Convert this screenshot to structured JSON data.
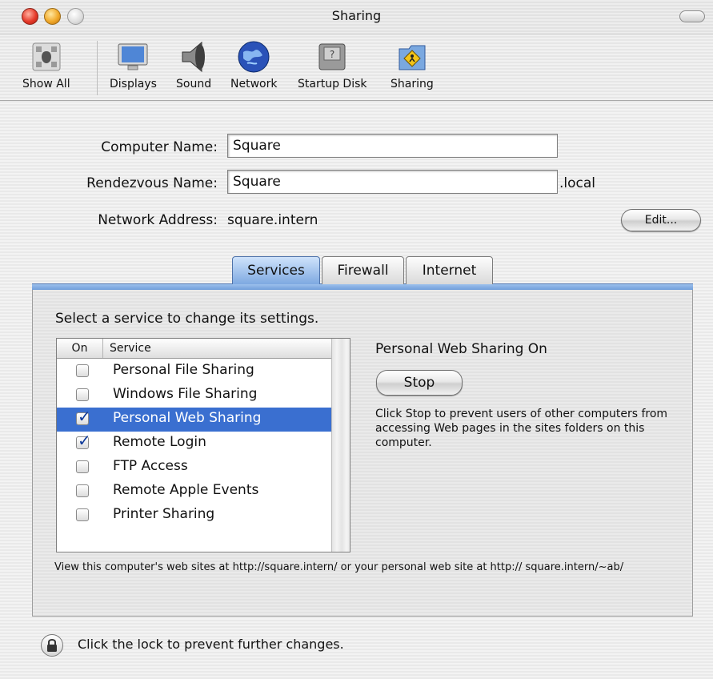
{
  "window": {
    "title": "Sharing"
  },
  "toolbar": {
    "items": [
      {
        "label": "Show All",
        "icon": "apple-grid-icon"
      },
      {
        "label": "Displays",
        "icon": "display-icon"
      },
      {
        "label": "Sound",
        "icon": "speaker-icon"
      },
      {
        "label": "Network",
        "icon": "globe-icon"
      },
      {
        "label": "Startup Disk",
        "icon": "disk-icon"
      },
      {
        "label": "Sharing",
        "icon": "sharing-folder-icon"
      }
    ]
  },
  "form": {
    "computer_name_label": "Computer Name:",
    "computer_name_value": "Square",
    "rendezvous_label": "Rendezvous Name:",
    "rendezvous_value": "Square",
    "rendezvous_suffix": ".local",
    "network_address_label": "Network Address:",
    "network_address_value": "square.intern",
    "edit_button": "Edit..."
  },
  "tabs": [
    {
      "label": "Services",
      "active": true
    },
    {
      "label": "Firewall",
      "active": false
    },
    {
      "label": "Internet",
      "active": false
    }
  ],
  "services": {
    "instruction": "Select a service to change its settings.",
    "col_on": "On",
    "col_service": "Service",
    "rows": [
      {
        "label": "Personal File Sharing",
        "checked": false,
        "selected": false
      },
      {
        "label": "Windows File Sharing",
        "checked": false,
        "selected": false
      },
      {
        "label": "Personal Web Sharing",
        "checked": true,
        "selected": true
      },
      {
        "label": "Remote Login",
        "checked": true,
        "selected": false
      },
      {
        "label": "FTP Access",
        "checked": false,
        "selected": false
      },
      {
        "label": "Remote Apple Events",
        "checked": false,
        "selected": false
      },
      {
        "label": "Printer Sharing",
        "checked": false,
        "selected": false
      }
    ],
    "detail_title": "Personal Web Sharing On",
    "stop_button": "Stop",
    "detail_desc": "Click Stop to prevent users of other computers from accessing Web pages in the sites folders on this computer.",
    "footer": "View this computer's web sites at http://square.intern/ or your personal web site at http:// square.intern/~ab/"
  },
  "lock": {
    "text": "Click the lock to prevent further changes.",
    "icon": "lock-icon"
  },
  "colors": {
    "selection": "#3a6fd0",
    "tab_active": "#7ea9e1"
  }
}
